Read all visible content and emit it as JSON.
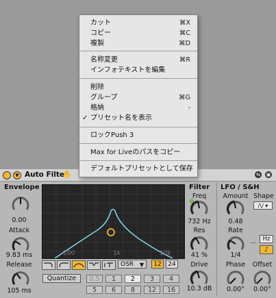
{
  "menu": {
    "items": [
      {
        "label": "カット",
        "shortcut": "⌘X"
      },
      {
        "label": "コピー",
        "shortcut": "⌘C"
      },
      {
        "label": "複製",
        "shortcut": "⌘D"
      },
      {
        "label": "名称変更",
        "shortcut": "⌘R"
      },
      {
        "label": "インフォテキストを編集",
        "shortcut": ""
      },
      {
        "label": "削除",
        "shortcut": ""
      },
      {
        "label": "グループ",
        "shortcut": "⌘G"
      },
      {
        "label": "格納",
        "shortcut": "-"
      },
      {
        "label": "プリセット名を表示",
        "shortcut": "",
        "check": "✓"
      },
      {
        "label": "ロックPush 3",
        "shortcut": ""
      },
      {
        "label": "Max for Liveのパスをコピー",
        "shortcut": ""
      },
      {
        "label": "デフォルトプリセットとして保存",
        "shortcut": ""
      }
    ]
  },
  "device": {
    "title": "Auto Filter",
    "envelope": {
      "title": "Envelope",
      "amount_value": "0.00",
      "attack_label": "Attack",
      "attack_value": "9.83 ms",
      "release_label": "Release",
      "release_value": "105 ms"
    },
    "graph": {
      "ticks": [
        "100",
        "1k",
        "10k"
      ]
    },
    "osr_label": "OSR",
    "osr_arrow": "▼",
    "slope_12": "12",
    "slope_24": "24",
    "quantize_label": "Quantize",
    "quantize_values": [
      "0.5",
      "1",
      "2",
      "3",
      "4",
      "5",
      "6",
      "8",
      "12",
      "16"
    ],
    "filter": {
      "title": "Filter",
      "freq_label": "Freq",
      "freq_value": "732 Hz",
      "res_label": "Res",
      "res_value": "41 %",
      "drive_label": "Drive",
      "drive_value": "10.3 dB"
    },
    "lfo": {
      "title": "LFO / S&H",
      "amount_label": "Amount",
      "amount_value": "0.48",
      "shape_label": "Shape",
      "shape_value": "/\\/ ▾",
      "rate_label": "Rate",
      "rate_value": "1/4",
      "hz_label": "Hz",
      "note_symbol": "♪",
      "sync_dash": "—",
      "phase_label": "Phase",
      "phase_value": "0.00°",
      "offset_label": "Offset",
      "offset_value": "0.00°"
    }
  },
  "colors": {
    "accent": "#f2b632",
    "curve": "#7ed3e6",
    "graph_bg": "#262626"
  }
}
